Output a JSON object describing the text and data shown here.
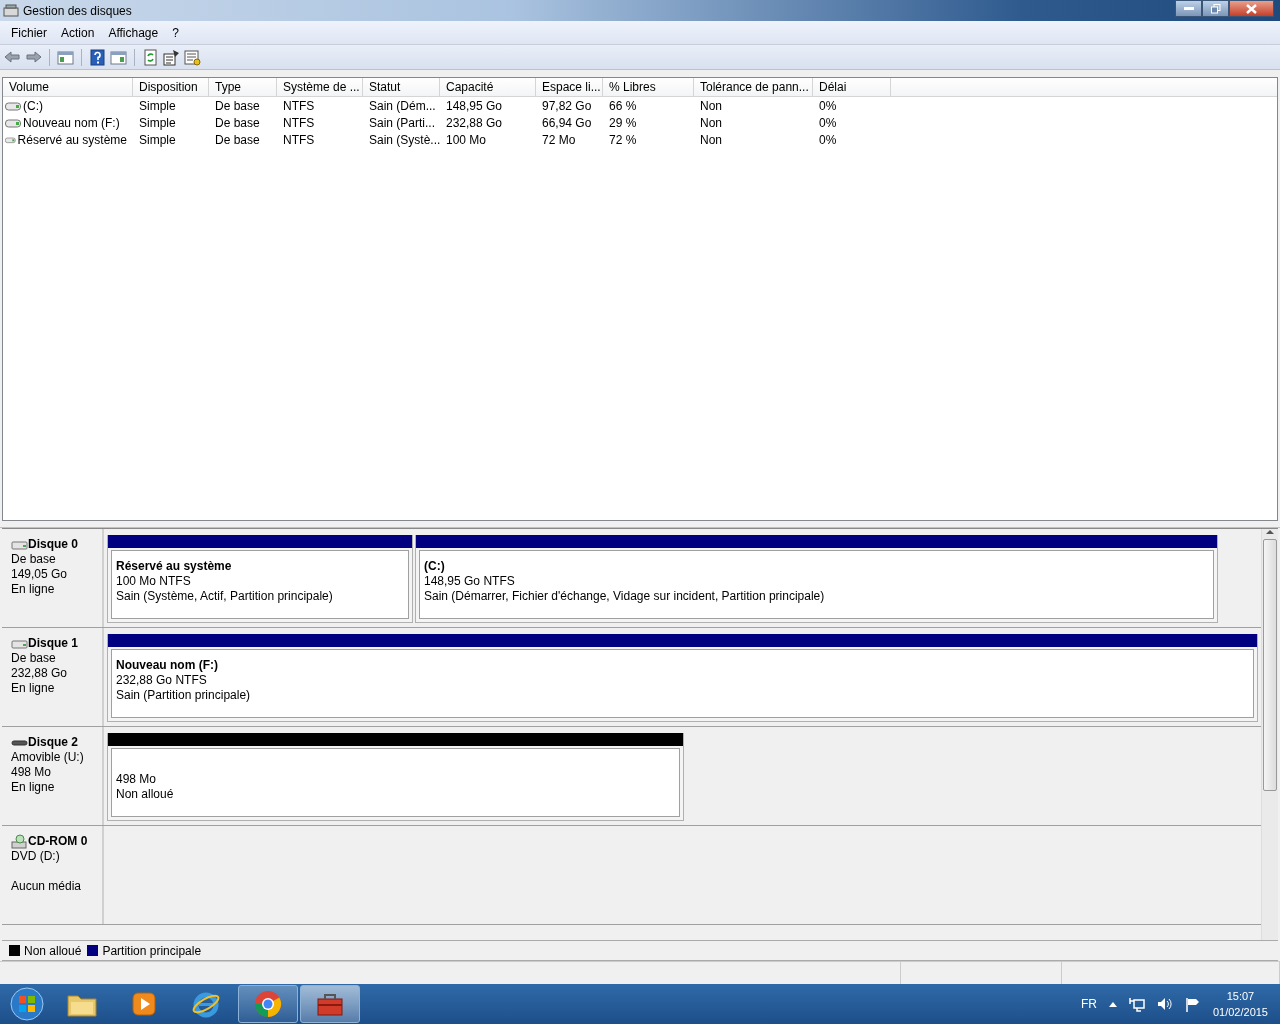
{
  "window": {
    "title": "Gestion des disques"
  },
  "menu": [
    "Fichier",
    "Action",
    "Affichage",
    "?"
  ],
  "table": {
    "columns": [
      "Volume",
      "Disposition",
      "Type",
      "Système de ...",
      "Statut",
      "Capacité",
      "Espace li...",
      "% Libres",
      "Tolérance de pann...",
      "Délai"
    ],
    "rows": [
      {
        "cells": [
          " (C:)",
          "Simple",
          "De base",
          "NTFS",
          "Sain (Dém...",
          "148,95 Go",
          "97,82 Go",
          "66 %",
          "Non",
          "0%"
        ]
      },
      {
        "cells": [
          "Nouveau nom (F:)",
          "Simple",
          "De base",
          "NTFS",
          "Sain (Parti...",
          "232,88 Go",
          "66,94 Go",
          "29 %",
          "Non",
          "0%"
        ]
      },
      {
        "cells": [
          "Réservé au système",
          "Simple",
          "De base",
          "NTFS",
          "Sain (Systè...",
          "100 Mo",
          "72 Mo",
          "72 %",
          "Non",
          "0%"
        ]
      }
    ]
  },
  "disks": [
    {
      "kind": "disk",
      "name": "Disque 0",
      "lines": [
        "De base",
        "149,05 Go",
        "En ligne"
      ],
      "partitions": [
        {
          "kind": "primary",
          "title": "Réservé au système",
          "size": "100 Mo NTFS",
          "status": "Sain (Système, Actif, Partition principale)"
        },
        {
          "kind": "primary",
          "title": "(C:)",
          "size": "148,95 Go NTFS",
          "status": "Sain (Démarrer, Fichier d'échange, Vidage sur incident, Partition principale)"
        }
      ]
    },
    {
      "kind": "disk",
      "name": "Disque 1",
      "lines": [
        "De base",
        "232,88 Go",
        "En ligne"
      ],
      "partitions": [
        {
          "kind": "primary",
          "title": "Nouveau nom  (F:)",
          "size": "232,88 Go NTFS",
          "status": "Sain (Partition principale)"
        }
      ]
    },
    {
      "kind": "removable",
      "name": "Disque 2",
      "lines": [
        "Amovible (U:)",
        "498 Mo",
        "En ligne"
      ],
      "partitions": [
        {
          "kind": "unallocated",
          "size": "498 Mo",
          "status": "Non alloué"
        }
      ]
    },
    {
      "kind": "cdrom",
      "name": "CD-ROM 0",
      "lines": [
        "DVD (D:)",
        "Aucun média"
      ]
    }
  ],
  "legend": [
    {
      "label": "Non alloué",
      "color": "#000000"
    },
    {
      "label": "Partition principale",
      "color": "#000080"
    }
  ],
  "taskbar": {
    "items": [
      {
        "kind": "explorer",
        "running": false,
        "selected": false
      },
      {
        "kind": "media",
        "running": false,
        "selected": false
      },
      {
        "kind": "ie",
        "running": false,
        "selected": false
      },
      {
        "kind": "chrome",
        "running": true,
        "selected": false
      },
      {
        "kind": "toolbox",
        "running": true,
        "selected": true
      }
    ],
    "language": "FR",
    "time": "15:07",
    "date": "01/02/2015"
  }
}
